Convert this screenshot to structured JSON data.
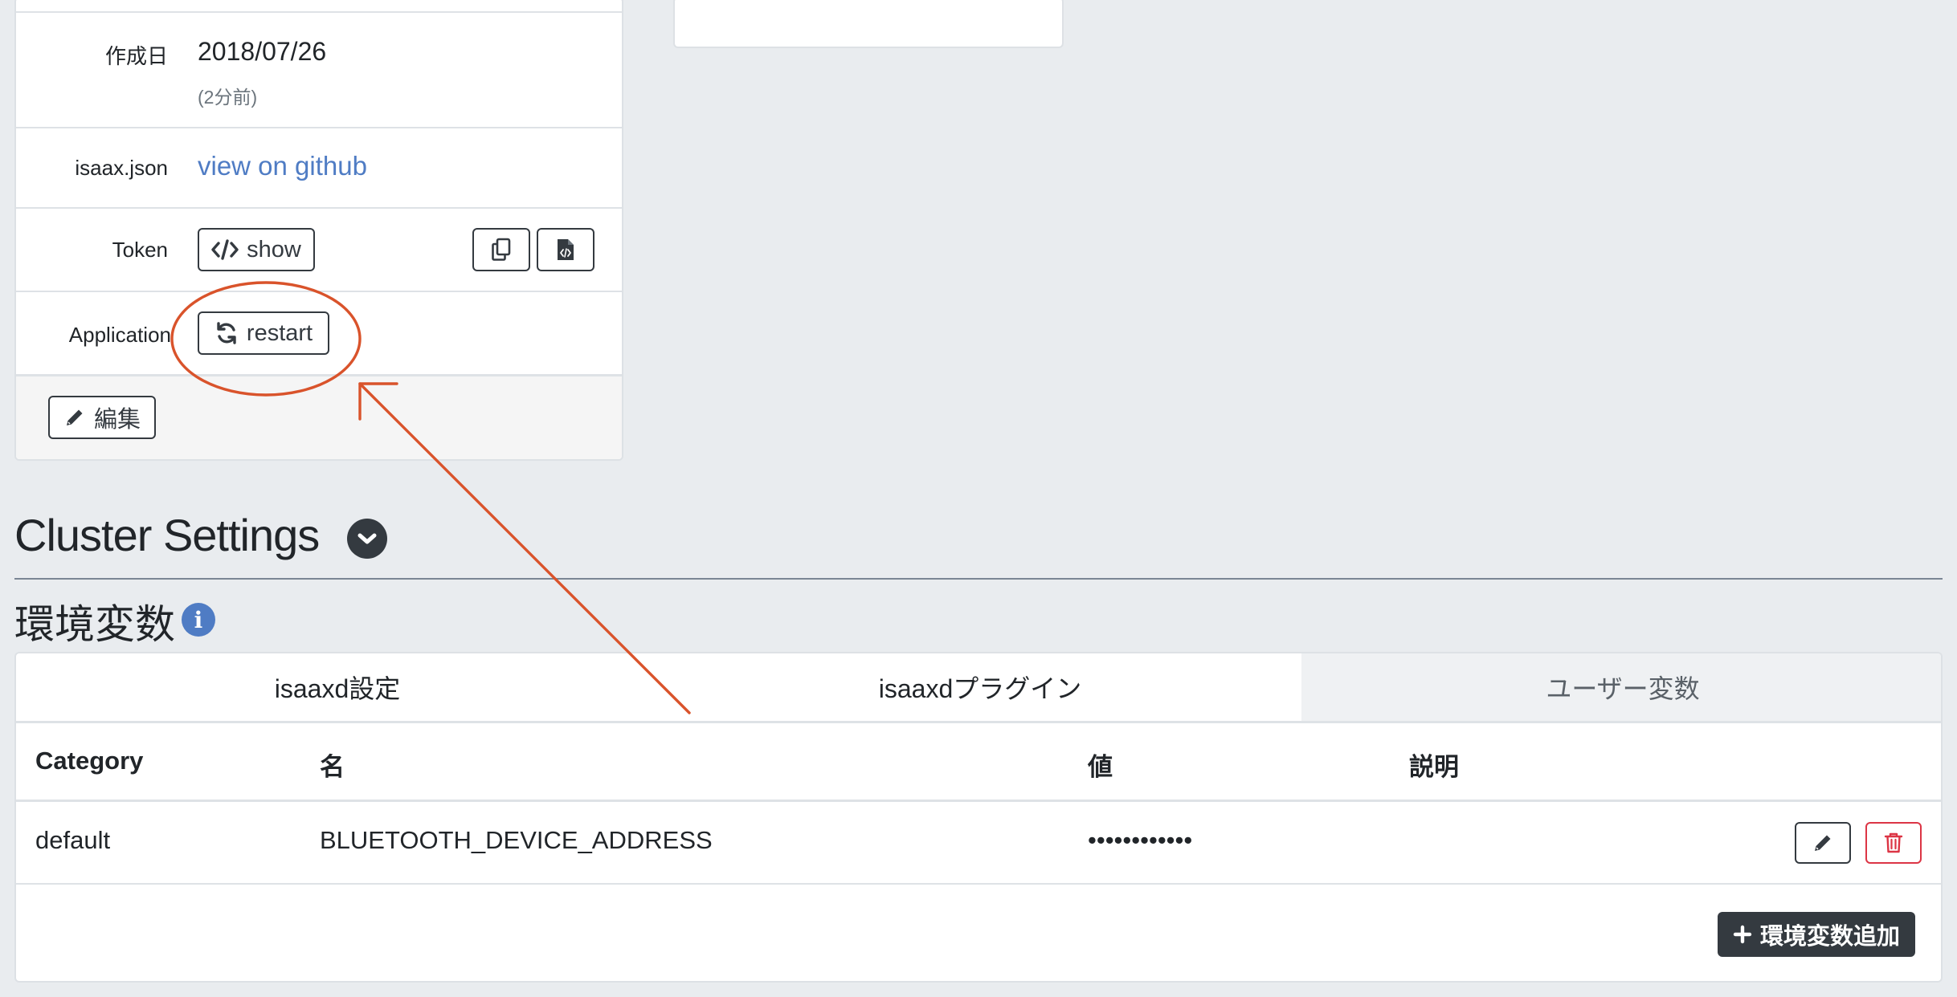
{
  "info_card": {
    "created": {
      "label": "作成日",
      "date": "2018/07/26",
      "relative": "(2分前)"
    },
    "isaax_json": {
      "label": "isaax.json",
      "link_text": "view on github"
    },
    "token": {
      "label": "Token",
      "show_label": "show"
    },
    "application": {
      "label": "Application",
      "restart_label": "restart"
    },
    "edit_label": "編集"
  },
  "cluster_settings": {
    "title": "Cluster Settings"
  },
  "env_vars": {
    "title": "環境変数",
    "info_glyph": "i",
    "tabs": [
      {
        "label": "isaaxd設定"
      },
      {
        "label": "isaaxdプラグイン"
      },
      {
        "label": "ユーザー変数"
      }
    ],
    "active_tab": 2,
    "columns": [
      "Category",
      "名",
      "値",
      "説明"
    ],
    "rows": [
      {
        "category": "default",
        "name": "BLUETOOTH_DEVICE_ADDRESS",
        "value": "••••••••••••",
        "description": ""
      }
    ],
    "add_label": "環境変数追加"
  },
  "colors": {
    "background": "#e9ecef",
    "link": "#4f7cc4",
    "dark": "#343a40",
    "danger": "#dc3545",
    "annotation": "#d9532b"
  },
  "icons": {
    "token_show": "code-icon",
    "copy": "copy-icon",
    "file_code": "file-code-icon",
    "restart": "sync-icon",
    "edit": "pencil-icon",
    "collapse": "chevron-down-icon",
    "info": "info-icon",
    "delete": "trash-icon",
    "add": "plus-icon"
  }
}
